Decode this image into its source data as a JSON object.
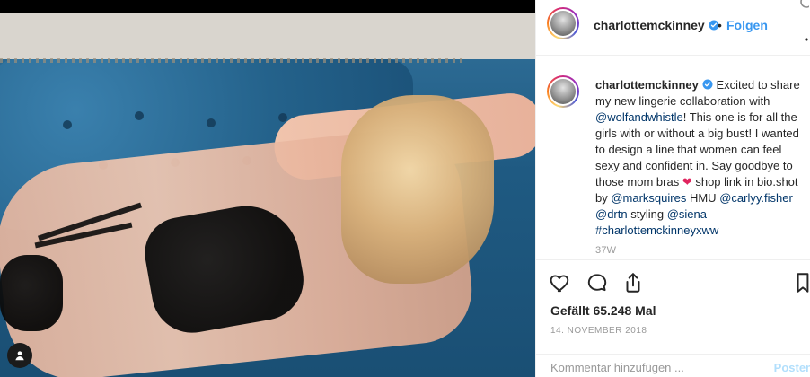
{
  "colors": {
    "accent": "#3897f0",
    "mention": "#003569",
    "verified": "#3897f0",
    "heart": "#e0245e",
    "muted": "#999999",
    "border": "#efefef"
  },
  "header": {
    "username": "charlottemckinney",
    "separator": "•",
    "follow_label": "Folgen",
    "more_icon": "more-horizontal-icon"
  },
  "caption": {
    "username": "charlottemckinney",
    "text_1": " Excited to share my new lingerie collaboration with ",
    "mention_1": "@wolfandwhistle",
    "text_2": "! This one is for all the girls with or without a big bust! I wanted to design a line that women can feel sexy and confident in. Say goodbye to those mom bras ",
    "heart_emoji": "❤",
    "text_3": " shop link in bio.shot by ",
    "mention_2": "@marksquires",
    "text_4": " HMU ",
    "mention_3": "@carlyy.fisher",
    "text_5": " ",
    "mention_4": "@drtn",
    "text_6": " styling ",
    "mention_5": "@siena",
    "text_7": " ",
    "hashtag_1": "#charlottemckinneyxww",
    "time_label": "37W"
  },
  "actions": {
    "like_icon": "heart-outline-icon",
    "comment_icon": "comment-icon",
    "share_icon": "share-icon",
    "save_icon": "bookmark-icon"
  },
  "stats": {
    "likes_text": "Gefällt 65.248 Mal",
    "date_text": "14. NOVEMBER 2018"
  },
  "comment": {
    "placeholder": "Kommentar hinzufügen ...",
    "post_label": "Posten"
  }
}
